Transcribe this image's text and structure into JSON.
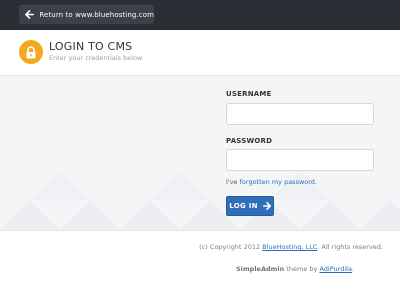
{
  "topbar": {
    "return_label": "Return to www.bluehosting.com",
    "icon": "arrow-left-icon"
  },
  "header": {
    "icon": "lock-icon",
    "title": "LOGIN TO CMS",
    "subtitle": "Enter your credentials below"
  },
  "form": {
    "username_label": "USERNAME",
    "username_value": "",
    "password_label": "PASSWORD",
    "password_value": "",
    "forgot_prefix": "I've ",
    "forgot_link": "forgotten my password",
    "forgot_suffix": ".",
    "login_label": "LOG IN",
    "login_icon": "arrow-right-icon"
  },
  "footer": {
    "copyright_prefix": "(c) Copyright 2012 ",
    "company_link": "BlueHosting, LLC",
    "copyright_suffix": ". All rights reserved.",
    "theme_name": "SimpleAdmin",
    "theme_middle": " theme by ",
    "author_link": "AdiPurdila",
    "theme_suffix": "."
  },
  "colors": {
    "topbar": "#2b2f35",
    "accent_orange": "#f3a81e",
    "button_blue": "#2f6fba",
    "link_blue": "#2a6db5",
    "main_bg": "#f4f5f7"
  }
}
